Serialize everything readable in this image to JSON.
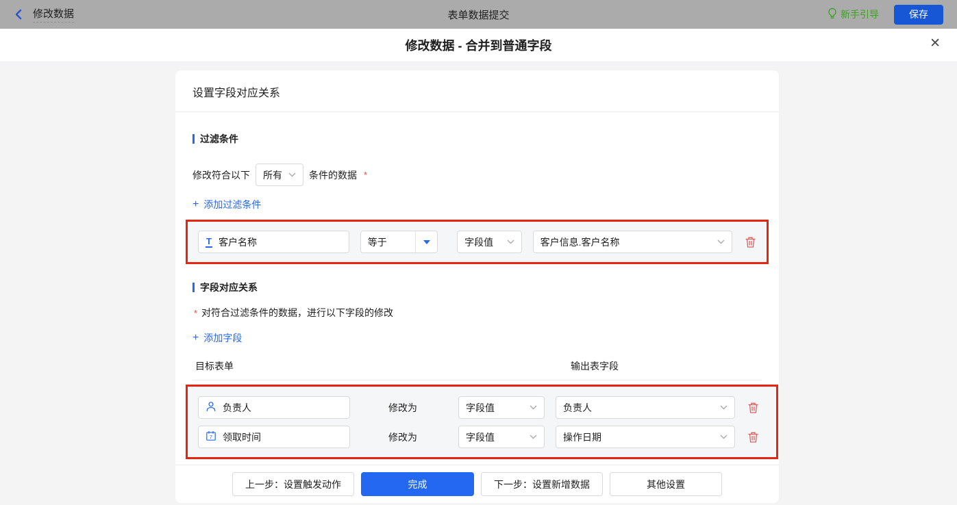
{
  "topbar": {
    "back_label": "修改数据",
    "center_title": "表单数据提交",
    "guide_label": "新手引导",
    "save_label": "保存"
  },
  "modal": {
    "title": "修改数据 - 合并到普通字段",
    "close_glyph": "✕"
  },
  "card": {
    "header": "设置字段对应关系"
  },
  "filter_section": {
    "title": "过滤条件",
    "sentence_prefix": "修改符合以下",
    "match_select_value": "所有",
    "sentence_suffix": "条件的数据",
    "required_mark": "*",
    "add_plus": "+",
    "add_label": "添加过滤条件",
    "row": {
      "field_icon_glyph": "T",
      "field": "客户名称",
      "operator": "等于",
      "value_type": "字段值",
      "value": "客户信息.客户名称"
    }
  },
  "mapping_section": {
    "title": "字段对应关系",
    "required_mark": "*",
    "note": "对符合过滤条件的数据，进行以下字段的修改",
    "add_plus": "+",
    "add_label": "添加字段",
    "col_target": "目标表单",
    "col_output": "输出表字段",
    "rows": [
      {
        "field": "负责人",
        "modify_label": "修改为",
        "value_type": "字段值",
        "output": "负责人"
      },
      {
        "field": "领取时间",
        "modify_label": "修改为",
        "value_type": "字段值",
        "output": "操作日期"
      }
    ]
  },
  "footer": {
    "prev_label": "上一步：设置触发动作",
    "done_label": "完成",
    "next_label": "下一步：设置新增数据",
    "other_label": "其他设置"
  },
  "colors": {
    "accent_blue": "#2468f2",
    "highlight_red": "#e62412",
    "danger_red": "#e05c5c",
    "guide_green": "#3ba220",
    "topbar_gray": "#ababab"
  }
}
